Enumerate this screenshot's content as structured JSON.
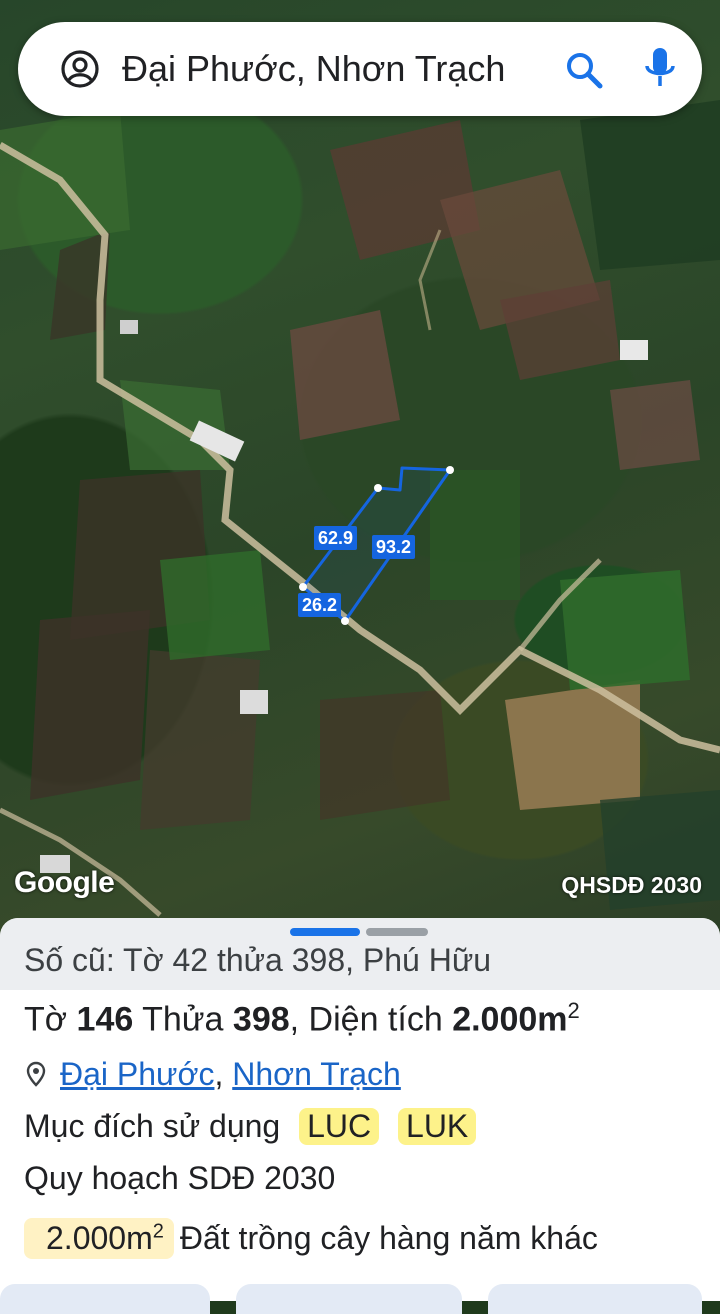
{
  "search": {
    "query": "Đại Phước, Nhơn Trạch",
    "icons": {
      "account": "account-circle-icon",
      "search": "search-icon",
      "mic": "microphone-icon"
    }
  },
  "map": {
    "attribution": "Google",
    "layer": "QHSDĐ 2030",
    "plot_dimensions": [
      "62.9",
      "93.2",
      "26.2"
    ],
    "plot_outline_color": "#1565e0"
  },
  "sheet": {
    "old_parcel": "Số cũ: Tờ 42 thửa 398, Phú Hữu",
    "parcel": {
      "sheet_label": "Tờ",
      "sheet_no": "146",
      "parcel_label": "Thửa",
      "parcel_no": "398",
      "area_label": ", Diện tích",
      "area_value": "2.000m",
      "area_unit_sup": "2"
    },
    "location": {
      "ward": "Đại Phước",
      "separator": ", ",
      "district": "Nhơn Trạch"
    },
    "purpose": {
      "label": "Mục đích sử dụng",
      "tags": [
        "LUC",
        "LUK"
      ]
    },
    "plan": "Quy hoạch SDĐ 2030",
    "zoning": {
      "area": "2.000m",
      "area_sup": "2",
      "description": "Đất trồng cây hàng năm khác"
    },
    "accent_color": "#1a73e8",
    "tag_color": "#fdf28a"
  }
}
